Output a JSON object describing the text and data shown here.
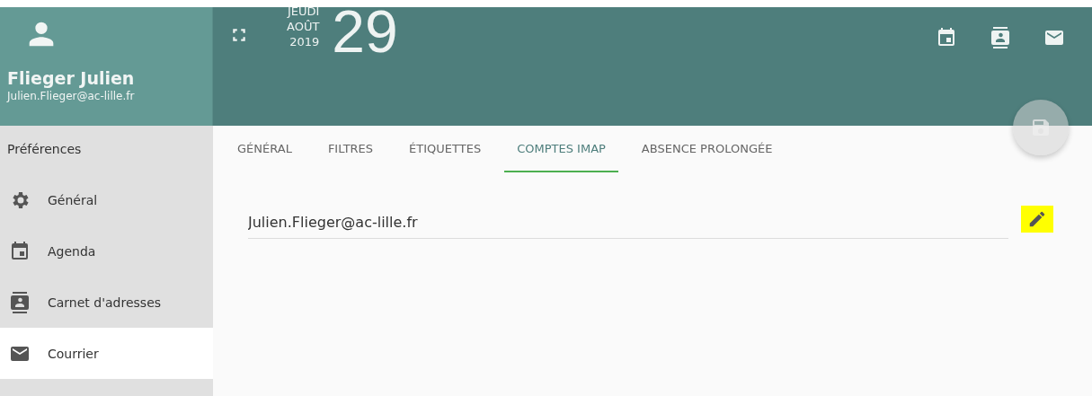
{
  "user": {
    "name": "Flieger Julien",
    "email": "Julien.Flieger@ac-lille.fr"
  },
  "date": {
    "weekday": "JEUDI",
    "month": "AOÛT",
    "year": "2019",
    "day": "29"
  },
  "header_actions": [
    {
      "kind": "calendar"
    },
    {
      "kind": "contacts"
    },
    {
      "kind": "mail"
    }
  ],
  "save_button": {
    "disabled": true
  },
  "sidebar": {
    "title": "Préférences",
    "items": [
      {
        "label": "Général",
        "kind": "gear",
        "selected": false
      },
      {
        "label": "Agenda",
        "kind": "calendar",
        "selected": false
      },
      {
        "label": "Carnet d'adresses",
        "kind": "contacts",
        "selected": false
      },
      {
        "label": "Courrier",
        "kind": "mail",
        "selected": true
      }
    ]
  },
  "tabs": [
    {
      "label": "GÉNÉRAL",
      "selected": false
    },
    {
      "label": "FILTRES",
      "selected": false
    },
    {
      "label": "ÉTIQUETTES",
      "selected": false
    },
    {
      "label": "COMPTES IMAP",
      "selected": true
    },
    {
      "label": "ABSENCE PROLONGÉE",
      "selected": false
    }
  ],
  "account": {
    "value": "Julien.Flieger@ac-lille.fr",
    "edit_highlighted": true
  }
}
